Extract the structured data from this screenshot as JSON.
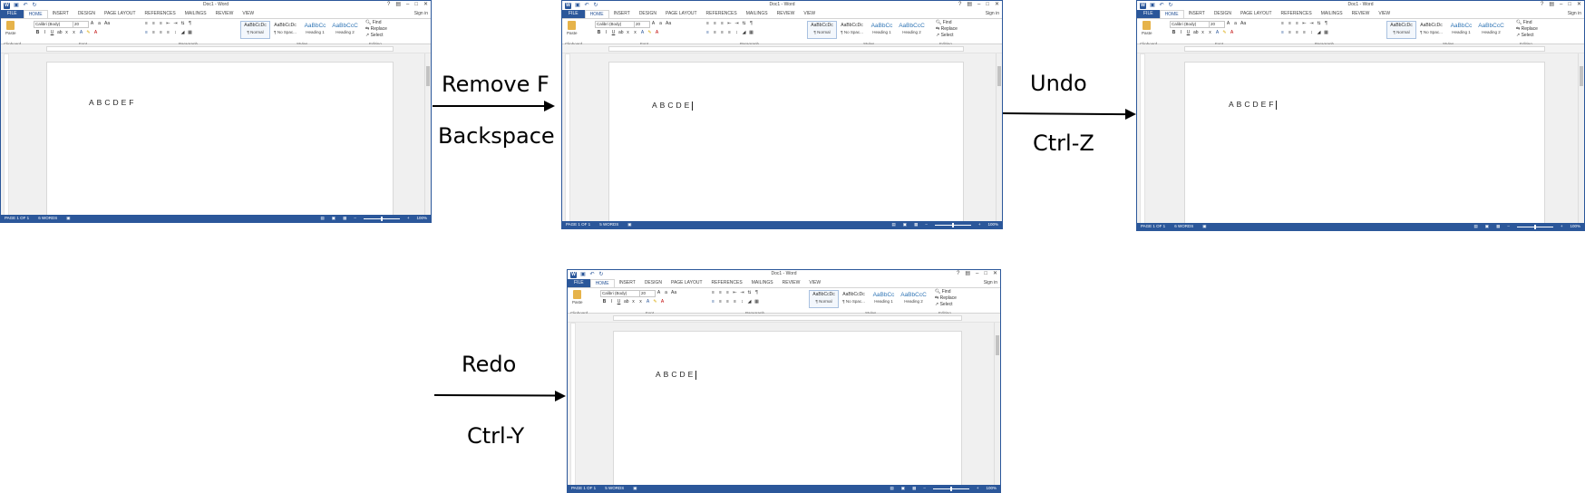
{
  "window_common": {
    "title": "Doc1 - Word",
    "tabs": [
      "FILE",
      "HOME",
      "INSERT",
      "DESIGN",
      "PAGE LAYOUT",
      "REFERENCES",
      "MAILINGS",
      "REVIEW",
      "VIEW"
    ],
    "sign_in": "Sign in",
    "clipboard": {
      "paste": "Paste",
      "label": "Clipboard"
    },
    "font": {
      "name": "Calibri (Body)",
      "size": "20",
      "label": "Font"
    },
    "paragraph_label": "Paragraph",
    "styles": {
      "label": "Styles",
      "items": [
        {
          "preview": "AaBbCcDc",
          "name": "¶ Normal"
        },
        {
          "preview": "AaBbCcDc",
          "name": "¶ No Spac..."
        },
        {
          "preview": "AaBbCc",
          "name": "Heading 1"
        },
        {
          "preview": "AaBbCcC",
          "name": "Heading 2"
        }
      ]
    },
    "editing": {
      "label": "Editing",
      "find": "Find",
      "replace": "Replace",
      "select": "Select"
    },
    "status": {
      "page": "PAGE 1 OF 1",
      "zoom": "100%"
    },
    "colors": {
      "word_blue": "#2b579a",
      "heading_blue": "#2e74b5"
    }
  },
  "windows": [
    {
      "id": "w1",
      "doc_text": "ABCDEF",
      "word_count": "6 WORDS",
      "caret": false
    },
    {
      "id": "w2",
      "doc_text": "ABCDE",
      "word_count": "5 WORDS",
      "caret": true
    },
    {
      "id": "w3",
      "doc_text": "ABCDEF",
      "word_count": "6 WORDS",
      "caret": true
    },
    {
      "id": "w4",
      "doc_text": "ABCDE",
      "word_count": "5 WORDS",
      "caret": true
    }
  ],
  "annotations": {
    "step1": {
      "action": "Remove F",
      "shortcut": "Backspace"
    },
    "step2": {
      "action": "Undo",
      "shortcut": "Ctrl-Z"
    },
    "step3": {
      "action": "Redo",
      "shortcut": "Ctrl-Y"
    }
  }
}
